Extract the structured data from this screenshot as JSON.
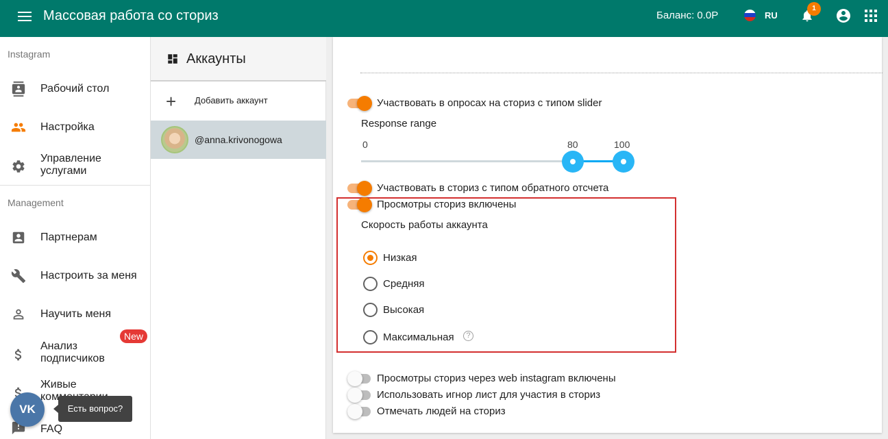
{
  "header": {
    "title": "Массовая работа со сториз",
    "balance": "Баланс: 0.0Р",
    "language": "RU",
    "notifications_count": "1"
  },
  "sidebar": {
    "section_instagram": "Instagram",
    "section_management": "Management",
    "items": [
      {
        "label": "Рабочий стол",
        "icon": "contact-card-icon"
      },
      {
        "label": "Настройка",
        "icon": "people-icon"
      },
      {
        "label": "Управление услугами",
        "icon": "gear-icon"
      },
      {
        "label": "Партнерам",
        "icon": "account-box-icon"
      },
      {
        "label": "Настроить за меня",
        "icon": "wrench-icon"
      },
      {
        "label": "Научить меня",
        "icon": "person-icon"
      },
      {
        "label": "Анализ подписчиков",
        "icon": "dollar-icon"
      },
      {
        "label": "Живые комментарии",
        "icon": "dollar-icon"
      },
      {
        "label": "FAQ",
        "icon": "alert-icon"
      }
    ],
    "new_badge": "New",
    "vk_label": "VK",
    "tooltip": "Есть вопрос?"
  },
  "accounts": {
    "title": "Аккаунты",
    "add_label": "Добавить аккаунт",
    "selected_account": "@anna.krivonogowa"
  },
  "settings": {
    "toggle_slider_polls": {
      "label": "Участвовать в опросах на сториз с типом slider",
      "on": true
    },
    "response_range": {
      "label": "Response range",
      "min": 0,
      "max": 100,
      "low": 80,
      "high": 100,
      "min_label": "0",
      "low_label": "80",
      "high_label": "100"
    },
    "toggle_countdown": {
      "label": "Участвовать в сториз с типом обратного отсчета",
      "on": true
    },
    "toggle_views": {
      "label": "Просмотры сториз включены",
      "on": true
    },
    "speed_label": "Скорость работы аккаунта",
    "speed_options": [
      {
        "label": "Низкая",
        "checked": true
      },
      {
        "label": "Средняя",
        "checked": false
      },
      {
        "label": "Высокая",
        "checked": false
      },
      {
        "label": "Максимальная",
        "checked": false
      }
    ],
    "toggle_web_views": {
      "label": "Просмотры сториз через web instagram включены",
      "on": false
    },
    "toggle_ignore_list": {
      "label": "Использовать игнор лист для участия в сториз",
      "on": false
    },
    "toggle_tag_people": {
      "label": "Отмечать людей на сториз",
      "on": false
    }
  },
  "colors": {
    "header_bg": "#00796b",
    "accent": "#f57c00",
    "slider": "#29b6f6",
    "highlight_border": "#d32f2f"
  }
}
